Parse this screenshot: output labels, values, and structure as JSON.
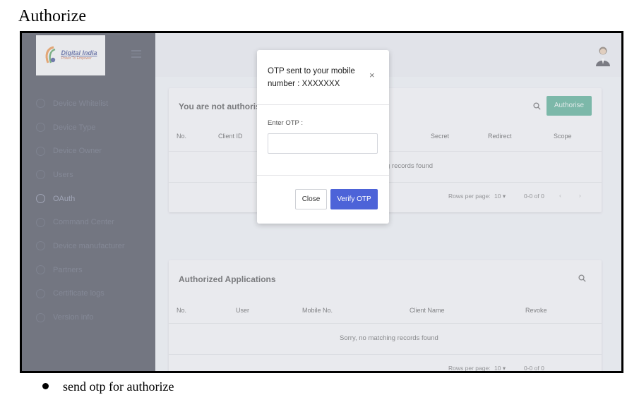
{
  "doc": {
    "title": "Authorize",
    "bullet": "send otp for authorize"
  },
  "app": {
    "logo": {
      "title": "Digital India",
      "tagline": "Power To Empower"
    },
    "sidebar": {
      "items": [
        {
          "label": "Device Whitelist",
          "icon": "whitelist-icon"
        },
        {
          "label": "Device Type",
          "icon": "device-type-icon"
        },
        {
          "label": "Device Owner",
          "icon": "device-owner-icon"
        },
        {
          "label": "Users",
          "icon": "users-icon"
        },
        {
          "label": "OAuth",
          "icon": "oauth-icon",
          "active": true
        },
        {
          "label": "Command Center",
          "icon": "command-center-icon"
        },
        {
          "label": "Device manufacturer",
          "icon": "manufacturer-icon"
        },
        {
          "label": "Partners",
          "icon": "partners-icon"
        },
        {
          "label": "Certificate logs",
          "icon": "certificate-icon"
        },
        {
          "label": "Version info",
          "icon": "version-icon"
        }
      ]
    },
    "card1": {
      "title": "You are not authorise t",
      "authorise_button": "Authorise",
      "columns": [
        "No.",
        "Client ID",
        "Secret",
        "Redirect",
        "Scope"
      ],
      "empty_message": "g records found",
      "pager": {
        "rows_label": "Rows per page:",
        "rows_value": "10",
        "range": "0-0 of 0"
      }
    },
    "card2": {
      "title": "Authorized Applications",
      "columns": [
        "No.",
        "User",
        "Mobile No.",
        "Client Name",
        "Revoke"
      ],
      "empty_message": "Sorry, no matching records found",
      "pager": {
        "rows_label": "Rows per page:",
        "rows_value": "10",
        "range": "0-0 of 0"
      }
    },
    "modal": {
      "title": "OTP sent to your mobile number : XXXXXXX",
      "close_symbol": "×",
      "otp_label": "Enter OTP :",
      "otp_value": "",
      "close_button": "Close",
      "verify_button": "Verify OTP"
    },
    "colors": {
      "sidebar_bg": "#1e2230",
      "authorise_btn": "#2e9a79",
      "verify_btn": "#4d63d8"
    }
  }
}
